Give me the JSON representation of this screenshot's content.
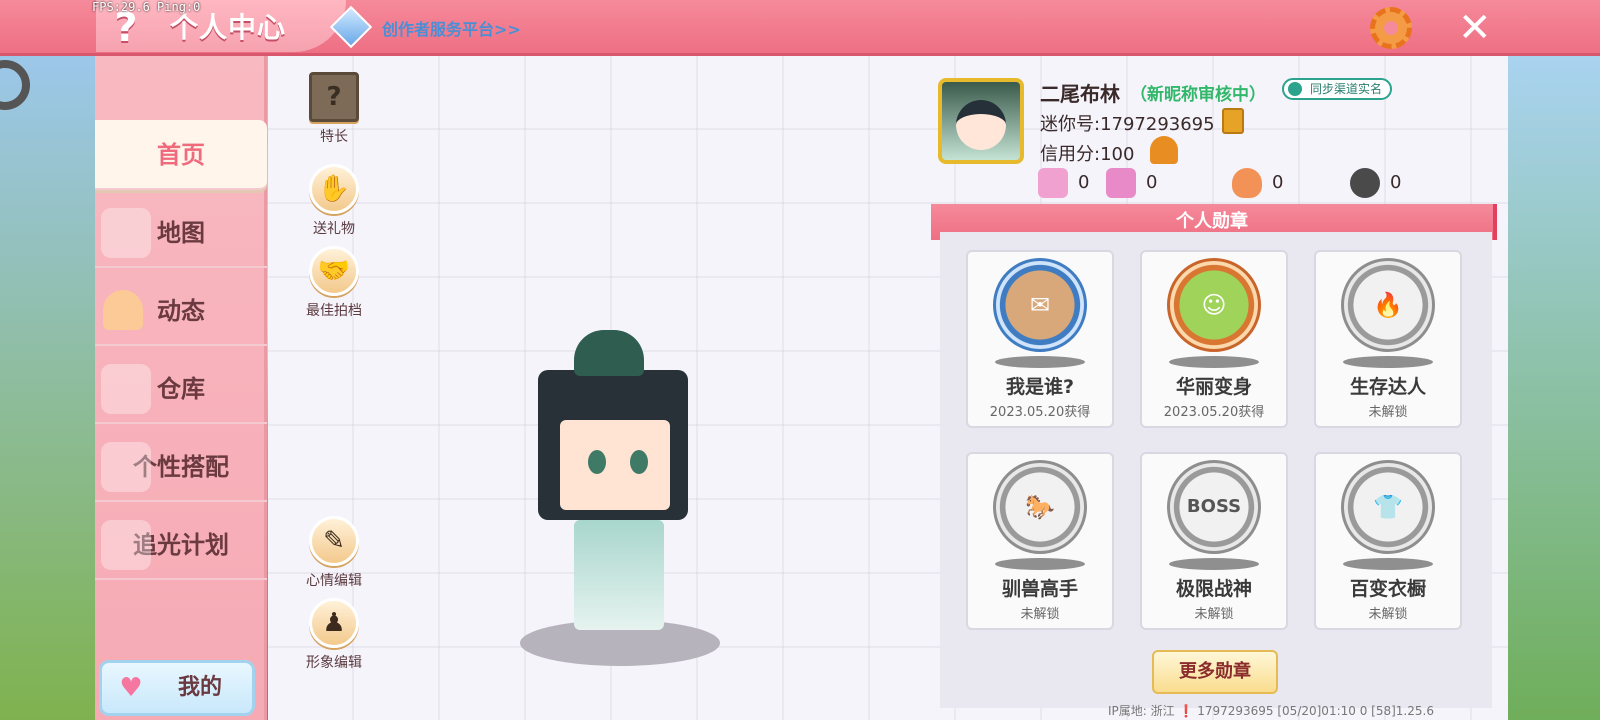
{
  "hud": {
    "fps": "FPS:29.6  Ping:0"
  },
  "header": {
    "help_glyph": "?",
    "title": "个人中心",
    "creator_link": "创作者服务平台>>",
    "close_glyph": "✕"
  },
  "sidebar": {
    "items": [
      {
        "label": "首页",
        "active": true
      },
      {
        "label": "地图"
      },
      {
        "label": "动态"
      },
      {
        "label": "仓库"
      },
      {
        "label": "个性搭配"
      },
      {
        "label": "追光计划"
      }
    ],
    "mine_label": "我的",
    "mine_icon": "heart-icon"
  },
  "tools": [
    {
      "label": "特长",
      "icon": "question-block-icon",
      "glyph": "?"
    },
    {
      "label": "送礼物",
      "icon": "gift-icon",
      "glyph": "✋"
    },
    {
      "label": "最佳拍档",
      "icon": "handshake-icon",
      "glyph": "🤝"
    },
    {
      "label": "心情编辑",
      "icon": "edit-icon",
      "glyph": "✎"
    },
    {
      "label": "形象编辑",
      "icon": "outfit-icon",
      "glyph": "♟"
    }
  ],
  "profile": {
    "nickname": "二尾布林",
    "nickname_status": "（新昵称审核中）",
    "sync_label": "同步渠道实名",
    "uid_text": "迷你号:1797293695",
    "credit_text": "信用分:100",
    "stats": [
      {
        "icon": "add-friend-icon",
        "value": "0",
        "color": "#f0a1d0"
      },
      {
        "icon": "fans-icon",
        "value": "0",
        "color": "#e889c8"
      },
      {
        "icon": "flame-icon",
        "value": "0",
        "color": "#f39256"
      },
      {
        "icon": "broken-heart-icon",
        "value": "0",
        "color": "#4a4a4a"
      }
    ]
  },
  "badges": {
    "header": "个人勋章",
    "items": [
      {
        "name": "我是谁?",
        "sub": "2023.05.20获得",
        "style": "blue",
        "glyph": "✉"
      },
      {
        "name": "华丽变身",
        "sub": "2023.05.20获得",
        "style": "orange",
        "glyph": "☺"
      },
      {
        "name": "生存达人",
        "sub": "未解锁",
        "style": "grey",
        "glyph": "🔥"
      },
      {
        "name": "驯兽高手",
        "sub": "未解锁",
        "style": "grey",
        "glyph": "🐎"
      },
      {
        "name": "极限战神",
        "sub": "未解锁",
        "style": "grey",
        "glyph": "BOSS"
      },
      {
        "name": "百变衣橱",
        "sub": "未解锁",
        "style": "grey",
        "glyph": "👕"
      }
    ],
    "more_label": "更多勋章"
  },
  "footer": {
    "text": "IP属地: 浙江 ❗    1797293695    [05/20]01:10 0   [58]1.25.6"
  },
  "colors": {
    "accent": "#ee6f84",
    "sidebar": "#f6aab4",
    "unlock_green": "#33b86b"
  }
}
